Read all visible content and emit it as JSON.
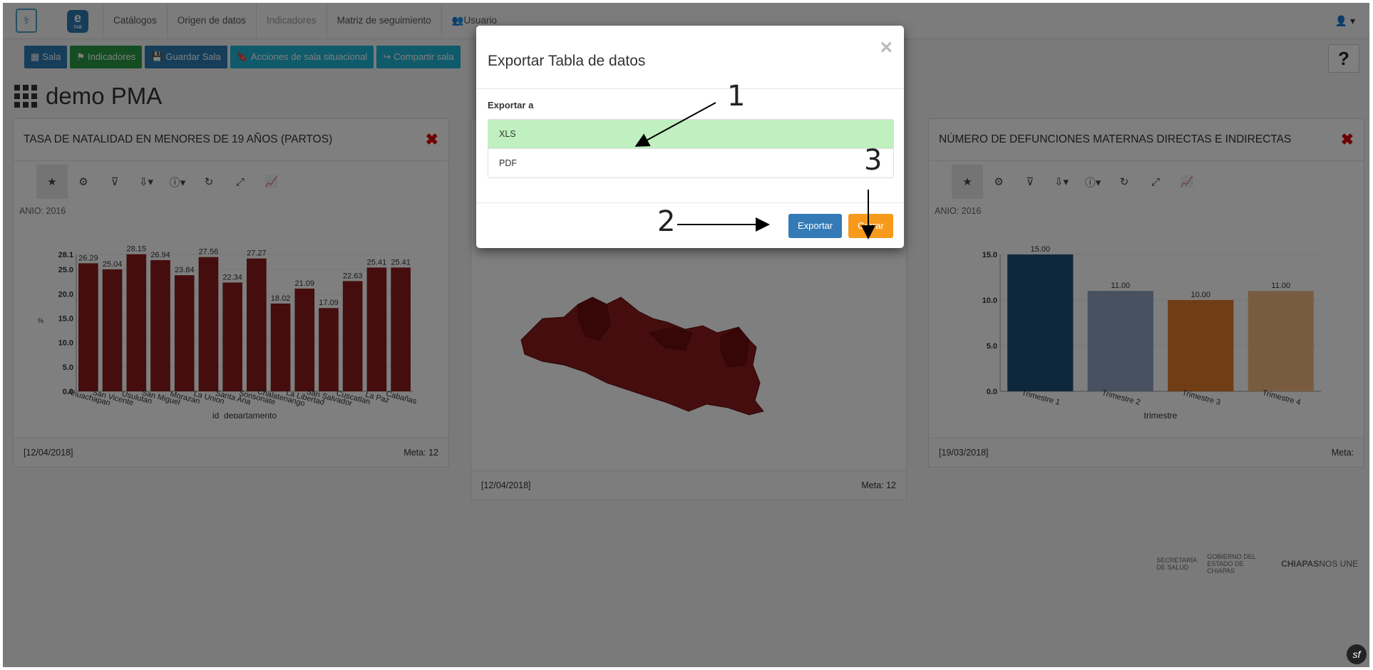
{
  "nav": {
    "items": [
      "Catálogos",
      "Origen de datos",
      "Indicadores",
      "Matriz de seguimiento",
      "Usuario"
    ],
    "logo_text": "e",
    "logo_small": "TAB"
  },
  "toolbar": {
    "sala": "Sala",
    "indicadores": "Indicadores",
    "guardar": "Guardar Sala",
    "acciones": "Acciones de sala situacional",
    "compartir": "Compartir sala"
  },
  "help": "?",
  "page_title": "demo PMA",
  "panel_left": {
    "title": "TASA DE NATALIDAD EN MENORES DE 19 AÑOS (PARTOS)",
    "anio": "ANIO: 2016",
    "footer_date": "[12/04/2018]",
    "footer_meta": "Meta: 12"
  },
  "panel_mid": {
    "footer_date": "[12/04/2018]",
    "footer_meta": "Meta: 12"
  },
  "panel_right": {
    "title": "NÚMERO DE DEFUNCIONES MATERNAS DIRECTAS E INDIRECTAS",
    "anio": "ANIO: 2016",
    "footer_date": "[19/03/2018]",
    "footer_meta": "Meta:"
  },
  "modal": {
    "title": "Exportar Tabla de datos",
    "label": "Exportar a",
    "options": [
      "XLS",
      "PDF"
    ],
    "export_button": "Exportar",
    "close_button": "Cerrar"
  },
  "annotations": [
    "1",
    "2",
    "3"
  ],
  "logos": {
    "sec": "SECRETARÍA",
    "sec2": "DE SALUD",
    "gob": "GOBIERNO DEL ESTADO DE CHIAPAS",
    "chiapas": "CHIAPAS",
    "nosune": "NOS UNE"
  },
  "chart_data": [
    {
      "type": "bar",
      "xlabel": "id_departamento",
      "ylabel": "%",
      "ylim": [
        0,
        28.1
      ],
      "y_ticks": [
        "0.0",
        "5.0",
        "10.0",
        "15.0",
        "20.0",
        "25.0",
        "28.1"
      ],
      "categories": [
        "Ahuachapan",
        "San Vicente",
        "Usulutan",
        "San Miguel",
        "Morazan",
        "La Union",
        "Santa Ana",
        "Sonsonate",
        "Chalatenango",
        "La Libertad",
        "San Salvador",
        "Cuscatlan",
        "La Paz",
        "Cabañas"
      ],
      "values": [
        26.29,
        25.04,
        28.15,
        26.94,
        23.84,
        27.56,
        22.34,
        27.27,
        18.02,
        21.09,
        17.09,
        22.63,
        25.41,
        25.41
      ],
      "labels": [
        "26.29",
        "25.04",
        "28.15",
        "26.94",
        "23.84",
        "27.56",
        "22.34",
        "27.27",
        "18.02",
        "21.09",
        "17.09",
        "22.63",
        "25.41",
        "25.41"
      ],
      "color": "#8b1a1a"
    },
    {
      "type": "bar",
      "xlabel": "trimestre",
      "ylim": [
        0,
        15
      ],
      "y_ticks": [
        "0.0",
        "5.0",
        "10.0",
        "15.0"
      ],
      "categories": [
        "Trimestre 1",
        "Trimestre 2",
        "Trimestre 3",
        "Trimestre 4"
      ],
      "values": [
        15,
        11,
        10,
        11
      ],
      "labels": [
        "15.00",
        "11.00",
        "10.00",
        "11.00"
      ],
      "colors": [
        "#1f4e79",
        "#8fa3bf",
        "#e07b2a",
        "#f2b880"
      ]
    }
  ]
}
